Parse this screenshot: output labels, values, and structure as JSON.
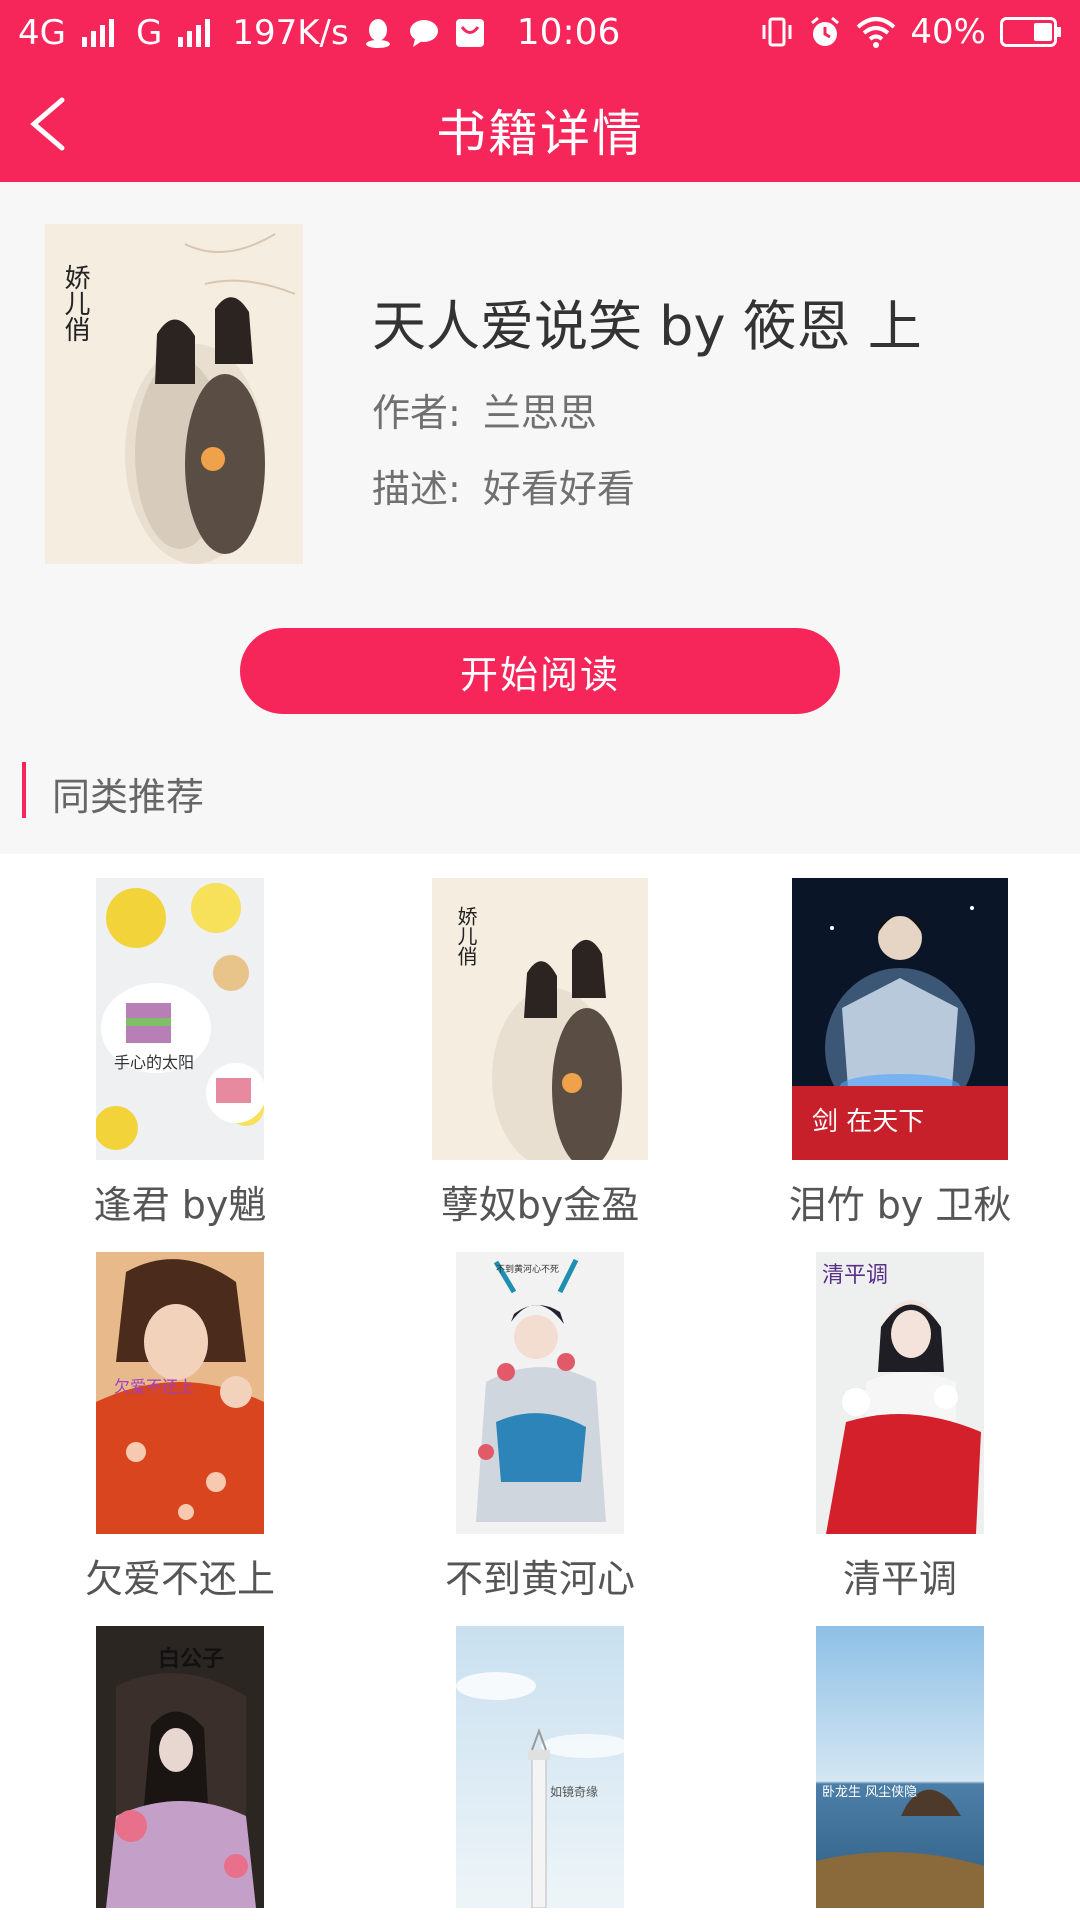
{
  "status_bar": {
    "network": "4G",
    "network2": "G",
    "speed": "197K/s",
    "time": "10:06",
    "battery": "40%",
    "icons": [
      "signal-icon",
      "qq-icon",
      "chat-bubble-icon",
      "mail-icon",
      "vibrate-icon",
      "alarm-icon",
      "wifi-icon",
      "battery-icon"
    ]
  },
  "header": {
    "title": "书籍详情",
    "back_icon": "chevron-left-icon"
  },
  "book": {
    "title": "天人爱说笑 by 筱恩 上",
    "author_label": "作者:",
    "author": "兰思思",
    "desc_label": "描述:",
    "desc": "好看好看",
    "cover_text": "娇儿俏"
  },
  "actions": {
    "start_reading": "开始阅读"
  },
  "recommend": {
    "title": "同类推荐",
    "items": [
      {
        "name": "逢君 by魈",
        "cover_text": "手心的太阳"
      },
      {
        "name": "孽奴by金盈",
        "cover_text": "娇儿俏"
      },
      {
        "name": "泪竹 by 卫秋",
        "cover_text": "剑 在天下"
      },
      {
        "name": "欠爱不还上",
        "cover_text": "欠爱不还上"
      },
      {
        "name": "不到黄河心",
        "cover_text": "不到黄河心不死"
      },
      {
        "name": "清平调",
        "cover_text": "清平调"
      },
      {
        "name": "",
        "cover_text": "白公子"
      },
      {
        "name": "",
        "cover_text": "如镜奇缘"
      },
      {
        "name": "",
        "cover_text": "卧龙生 风尘侠隐"
      }
    ]
  },
  "colors": {
    "accent": "#f7265a",
    "background": "#f7f7f8"
  }
}
